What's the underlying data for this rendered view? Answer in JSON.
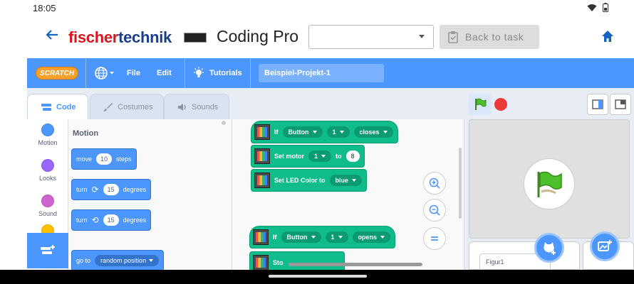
{
  "status": {
    "time": "18:05"
  },
  "appbar": {
    "logo_part1": "fischer",
    "logo_part2": "technik",
    "title": "Coding Pro",
    "task_select_value": "",
    "back_to_task": "Back to task"
  },
  "menu": {
    "scratch_logo": "SCRATCH",
    "file": "File",
    "edit": "Edit",
    "tutorials": "Tutorials",
    "project_name": "Beispiel-Projekt-1"
  },
  "tabs": {
    "code": "Code",
    "costumes": "Costumes",
    "sounds": "Sounds"
  },
  "categories": [
    {
      "label": "Motion",
      "color": "#4c97ff"
    },
    {
      "label": "Looks",
      "color": "#9966ff"
    },
    {
      "label": "Sound",
      "color": "#cf63cf"
    }
  ],
  "palette": {
    "title": "Motion",
    "move": {
      "label": "move",
      "value": "10",
      "suffix": "steps"
    },
    "turn_right": {
      "label": "turn",
      "value": "15",
      "suffix": "degrees"
    },
    "turn_left": {
      "label": "turn",
      "value": "15",
      "suffix": "degrees"
    },
    "goto": {
      "label": "go to",
      "value": "random position"
    }
  },
  "script1": {
    "if": "If",
    "button": "Button",
    "num": "1",
    "state": "closes",
    "set_motor": "Set motor",
    "motor_num": "1",
    "to": "to",
    "motor_value": "8",
    "set_led": "Set LED Color to",
    "led_color": "blue"
  },
  "script2": {
    "if": "If",
    "button": "Button",
    "num": "1",
    "state": "opens",
    "partial": "Sto"
  },
  "sprite": {
    "name": "Figur1"
  },
  "colors": {
    "scratch_blue": "#4c97ff",
    "extension_green": "#0fbd8c",
    "brand_red": "#d9171e",
    "brand_blue": "#1b3e8c"
  }
}
